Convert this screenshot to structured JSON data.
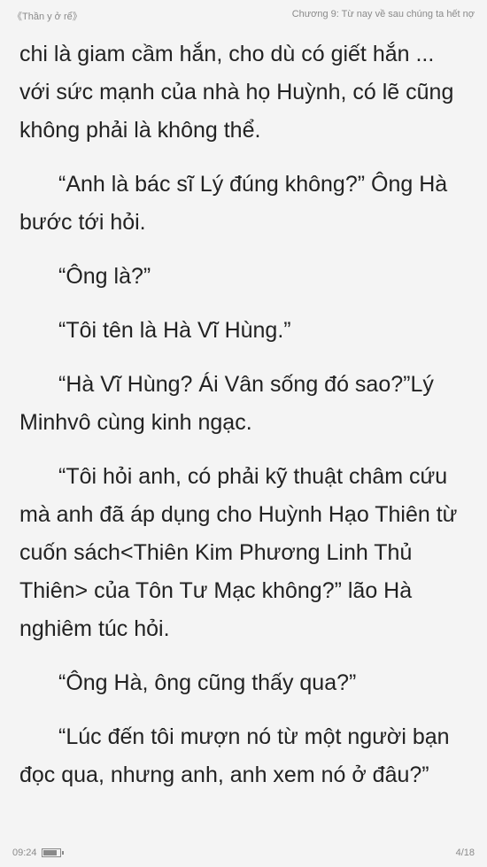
{
  "header": {
    "book_title": "《Thần y ở rể》",
    "chapter_title": "Chương 9: Từ nay về sau chúng ta hết nợ"
  },
  "paragraphs": [
    {
      "indent": false,
      "text": "chi là giam cầm hắn, cho dù có giết hắn ... với sức mạnh của nhà họ Huỳnh, có lẽ cũng không phải là không thể."
    },
    {
      "indent": true,
      "text": "“Anh là bác sĩ Lý đúng không?” Ông Hà bước tới hỏi."
    },
    {
      "indent": true,
      "text": "“Ông là?”"
    },
    {
      "indent": true,
      "text": "“Tôi tên là Hà Vĩ Hùng.”"
    },
    {
      "indent": true,
      "text": "“Hà Vĩ Hùng? Ái Vân sống đó sao?”Lý Minhvô cùng kinh ngạc."
    },
    {
      "indent": true,
      "text": "“Tôi hỏi anh, có phải kỹ thuật châm cứu mà anh đã áp dụng cho Huỳnh Hạo Thiên từ cuốn sách<Thiên Kim Phương Linh Thủ Thiên> của Tôn Tư Mạc không?” lão Hà nghiêm túc hỏi."
    },
    {
      "indent": true,
      "text": "“Ông Hà, ông cũng thấy qua?”"
    },
    {
      "indent": true,
      "text": "“Lúc đến tôi mượn nó từ một người bạn đọc qua, nhưng anh, anh xem nó ở đâu?”"
    }
  ],
  "status": {
    "time": "09:24",
    "battery_level": 0.85,
    "page": "4/18"
  },
  "colors": {
    "background": "#f4f4f4",
    "text": "#222222",
    "meta_text": "#8a8a8a"
  }
}
